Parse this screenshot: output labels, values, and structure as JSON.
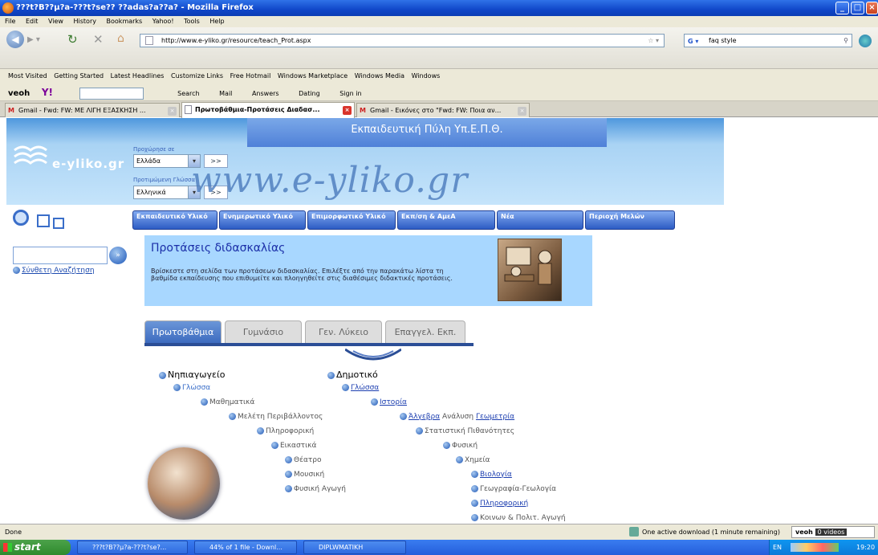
{
  "window": {
    "title": "???t?B??µ?a-???t?se?? ??adas?a??a? - Mozilla Firefox"
  },
  "menu": [
    "File",
    "Edit",
    "View",
    "History",
    "Bookmarks",
    "Yahoo!",
    "Tools",
    "Help"
  ],
  "nav": {
    "url": "http://www.e-yliko.gr/resource/teach_Prot.aspx",
    "search_value": "faq style"
  },
  "bookmarks": [
    "Most Visited",
    "Getting Started",
    "Latest Headlines",
    "Customize Links",
    "Free Hotmail",
    "Windows Marketplace",
    "Windows Media",
    "Windows"
  ],
  "toolbar3": {
    "veoh": "veoh",
    "yahoo": "Y!",
    "search": "Search",
    "mail": "Mail",
    "answers": "Answers",
    "dating": "Dating",
    "signin": "Sign in"
  },
  "tabs": [
    {
      "label": "Gmail - Fwd: FW: ΜΕ ΛΙΓΗ ΕΞΑΣΚΗΣΗ ..."
    },
    {
      "label": "Πρωτοβάθμια-Προτάσεις Διαδασ..."
    },
    {
      "label": "Gmail - Εικόνες στο \"Fwd: FW: Ποια αν..."
    }
  ],
  "site": {
    "portal_title": "Εκπαιδευτική Πύλη Υπ.Ε.Π.Θ.",
    "logo_text": "e-yliko.gr",
    "big_url": "www.e-yliko.gr",
    "go_to_label": "Προχώρησε σε",
    "go_to_value": "Ελλάδα",
    "lang_label": "Προτιμώμενη Γλώσσα",
    "lang_value": "Ελληνικά",
    "go_btn": ">>",
    "nav_buttons": [
      "Εκπαιδευτικό Υλικό",
      "Ενημερωτικό Υλικό",
      "Επιμορφωτικό Υλικό",
      "Εκπ/ση & ΑμεΑ",
      "Νέα",
      "Περιοχή Μελών"
    ],
    "advanced_search": "Σύνθετη Αναζήτηση",
    "proposals_title": "Προτάσεις διδασκαλίας",
    "proposals_text": "Βρίσκεστε στη σελίδα των προτάσεων διδασκαλίας. Επιλέξτε από την παρακάτω λίστα τη βαθμίδα εκπαίδευσης που επιθυμείτε και πλοηγηθείτε στις διαθέσιμες διδακτικές προτάσεις.",
    "section_tabs": [
      "Πρωτοβάθμια",
      "Γυμνάσιο",
      "Γεν. Λύκειο",
      "Επαγγελ. Εκπ."
    ],
    "kindergarten": {
      "title": "Νηπιαγωγείο",
      "items": [
        "Γλώσσα",
        "Μαθηματικά",
        "Μελέτη Περιβάλλοντος",
        "Πληροφορική",
        "Εικαστικά",
        "Θέατρο",
        "Μουσική",
        "Φυσική Αγωγή"
      ]
    },
    "primary": {
      "title": "Δημοτικό",
      "glossa": "Γλώσσα",
      "istoria": "Ιστορία",
      "algebra": "Άλγεβρα",
      "analysis": "Ανάλυση",
      "geometry": "Γεωμετρία",
      "statistics": "Στατιστική Πιθανότητες",
      "physics": "Φυσική",
      "chemistry": "Χημεία",
      "biology": "Βιολογία",
      "geography": "Γεωγραφία-Γεωλογία",
      "informatics": "Πληροφορική",
      "civics": "Κοινων & Πολιτ. Αγωγή"
    }
  },
  "status": {
    "left": "Done",
    "download": "One active download (1 minute remaining)",
    "veoh": "veoh",
    "videos": "0 videos"
  },
  "taskbar": {
    "start": "start",
    "tasks": [
      "???t?B??µ?a-???t?se?...",
      "44% of 1 file - Downl...",
      "DIPLWMATIKH"
    ],
    "lang": "EN",
    "clock": "19:20"
  }
}
